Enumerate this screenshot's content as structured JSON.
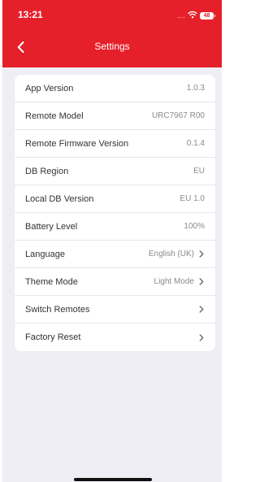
{
  "status_bar": {
    "time": "13:21",
    "signal": "....",
    "wifi_icon": "wifi-icon",
    "battery": "48"
  },
  "header": {
    "title": "Settings",
    "back_icon": "chevron-left-icon"
  },
  "settings": {
    "items": [
      {
        "label": "App Version",
        "value": "1.0.3",
        "chevron": false
      },
      {
        "label": "Remote Model",
        "value": "URC7967 R00",
        "chevron": false
      },
      {
        "label": "Remote Firmware Version",
        "value": "0.1.4",
        "chevron": false
      },
      {
        "label": "DB Region",
        "value": "EU",
        "chevron": false
      },
      {
        "label": "Local DB Version",
        "value": "EU 1.0",
        "chevron": false
      },
      {
        "label": "Battery Level",
        "value": "100%",
        "chevron": false
      },
      {
        "label": "Language",
        "value": "English (UK)",
        "chevron": true
      },
      {
        "label": "Theme Mode",
        "value": "Light Mode",
        "chevron": true
      },
      {
        "label": "Switch Remotes",
        "value": "",
        "chevron": true
      },
      {
        "label": "Factory Reset",
        "value": "",
        "chevron": true
      }
    ]
  },
  "colors": {
    "brand": "#e6202a",
    "background": "#eeeef4",
    "card": "#ffffff"
  }
}
